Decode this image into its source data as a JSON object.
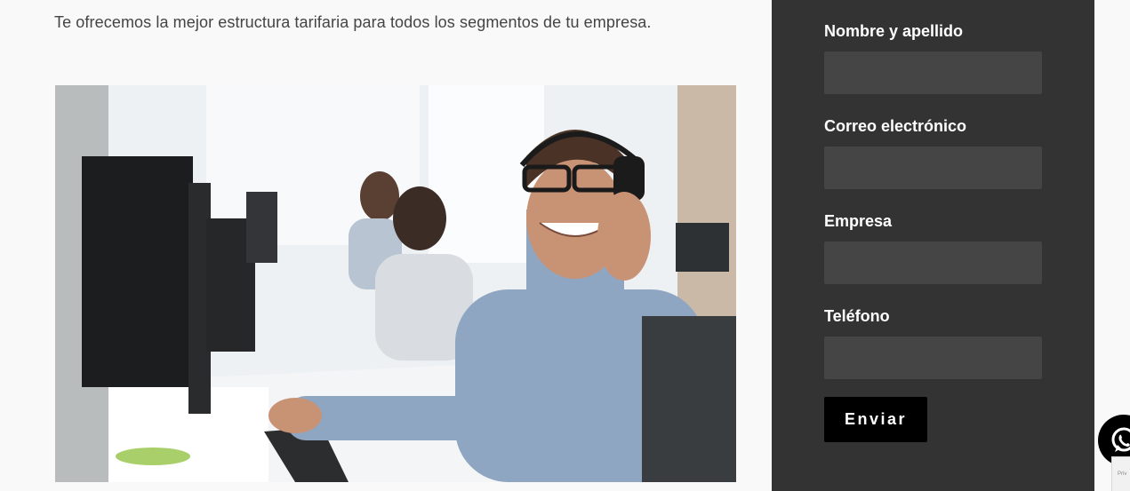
{
  "intro": {
    "text": "Te ofrecemos la mejor estructura tarifaria para todos los segmentos de tu empresa."
  },
  "form": {
    "fields": [
      {
        "label": "Nombre y apellido",
        "value": ""
      },
      {
        "label": "Correo electrónico",
        "value": ""
      },
      {
        "label": "Empresa",
        "value": ""
      },
      {
        "label": "Teléfono",
        "value": ""
      }
    ],
    "submit_label": "Enviar"
  },
  "floating": {
    "whatsapp_icon": "whatsapp-icon",
    "recaptcha_text": "Priv"
  },
  "colors": {
    "panel_bg": "#333333",
    "input_bg": "#454545",
    "button_bg": "#000000",
    "page_bg": "#f9f9f9"
  }
}
